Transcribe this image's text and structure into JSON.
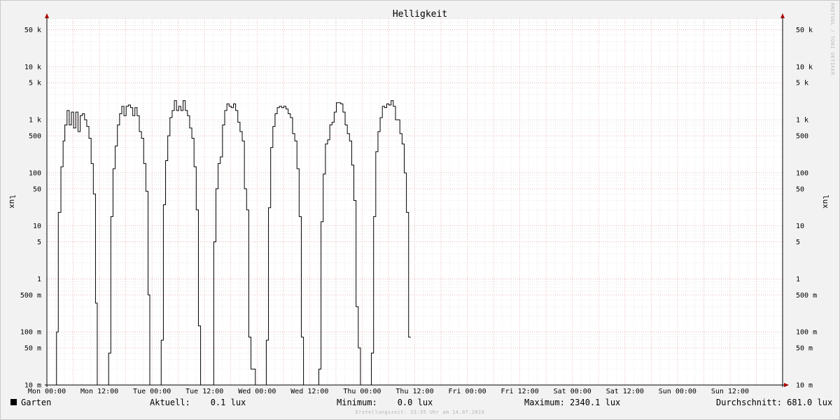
{
  "chart_data": {
    "type": "line",
    "title": "Helligkeit",
    "ylabel": "lux",
    "yscale": "log",
    "ylim": [
      0.01,
      80000
    ],
    "xlim": [
      0,
      168
    ],
    "grid": true,
    "y_tick_values": [
      0.01,
      0.05,
      0.1,
      0.5,
      1,
      5,
      10,
      50,
      100,
      500,
      1000,
      5000,
      10000,
      50000
    ],
    "y_tick_labels": [
      "10 m",
      "50 m",
      "100 m",
      "500 m",
      "1",
      "5",
      "10",
      "50",
      "100",
      "500",
      "1 k",
      "5 k",
      "10 k",
      "50 k"
    ],
    "x_tick_values": [
      0,
      12,
      24,
      36,
      48,
      60,
      72,
      84,
      96,
      108,
      120,
      132,
      144,
      156
    ],
    "x_tick_labels": [
      "Mon 00:00",
      "Mon 12:00",
      "Tue 00:00",
      "Tue 12:00",
      "Wed 00:00",
      "Wed 12:00",
      "Thu 00:00",
      "Thu 12:00",
      "Fri 00:00",
      "Fri 12:00",
      "Sat 00:00",
      "Sat 12:00",
      "Sun 00:00",
      "Sun 12:00"
    ],
    "series": [
      {
        "name": "Garten",
        "color": "#000000",
        "points": [
          [
            0,
            0.01
          ],
          [
            2.2,
            0.01
          ],
          [
            2.2,
            0.1
          ],
          [
            2.6,
            0.1
          ],
          [
            2.6,
            18
          ],
          [
            3.2,
            18
          ],
          [
            3.2,
            130
          ],
          [
            3.7,
            130
          ],
          [
            3.7,
            400
          ],
          [
            4.1,
            400
          ],
          [
            4.1,
            800
          ],
          [
            4.6,
            800
          ],
          [
            4.6,
            1500
          ],
          [
            5.1,
            1500
          ],
          [
            5.1,
            800
          ],
          [
            5.6,
            800
          ],
          [
            5.6,
            1400
          ],
          [
            6.1,
            1400
          ],
          [
            6.1,
            700
          ],
          [
            6.6,
            700
          ],
          [
            6.6,
            1400
          ],
          [
            7.1,
            1400
          ],
          [
            7.1,
            600
          ],
          [
            7.6,
            600
          ],
          [
            7.6,
            1200
          ],
          [
            8.1,
            1200
          ],
          [
            8.1,
            1300
          ],
          [
            8.6,
            1300
          ],
          [
            8.6,
            1000
          ],
          [
            9.1,
            1000
          ],
          [
            9.1,
            750
          ],
          [
            9.6,
            750
          ],
          [
            9.6,
            450
          ],
          [
            10.1,
            450
          ],
          [
            10.1,
            150
          ],
          [
            10.6,
            150
          ],
          [
            10.6,
            40
          ],
          [
            11.1,
            40
          ],
          [
            11.1,
            0.35
          ],
          [
            11.5,
            0.35
          ],
          [
            11.5,
            0.01
          ],
          [
            14.1,
            0.01
          ],
          [
            14.1,
            0.04
          ],
          [
            14.6,
            0.04
          ],
          [
            14.6,
            15
          ],
          [
            15.1,
            15
          ],
          [
            15.1,
            120
          ],
          [
            15.6,
            120
          ],
          [
            15.6,
            320
          ],
          [
            16.1,
            320
          ],
          [
            16.1,
            800
          ],
          [
            16.6,
            800
          ],
          [
            16.6,
            1300
          ],
          [
            17.1,
            1300
          ],
          [
            17.1,
            1800
          ],
          [
            17.6,
            1800
          ],
          [
            17.6,
            1200
          ],
          [
            18.1,
            1200
          ],
          [
            18.1,
            1800
          ],
          [
            18.6,
            1800
          ],
          [
            18.6,
            1900
          ],
          [
            19.1,
            1900
          ],
          [
            19.1,
            1700
          ],
          [
            19.6,
            1700
          ],
          [
            19.6,
            1200
          ],
          [
            20.1,
            1200
          ],
          [
            20.1,
            1700
          ],
          [
            20.6,
            1700
          ],
          [
            20.6,
            1200
          ],
          [
            21.1,
            1200
          ],
          [
            21.1,
            600
          ],
          [
            21.6,
            600
          ],
          [
            21.6,
            450
          ],
          [
            22.1,
            450
          ],
          [
            22.1,
            150
          ],
          [
            22.6,
            150
          ],
          [
            22.6,
            45
          ],
          [
            23.1,
            45
          ],
          [
            23.1,
            0.5
          ],
          [
            23.5,
            0.5
          ],
          [
            23.5,
            0.01
          ],
          [
            26.1,
            0.01
          ],
          [
            26.1,
            0.07
          ],
          [
            26.6,
            0.07
          ],
          [
            26.6,
            25
          ],
          [
            27.1,
            25
          ],
          [
            27.1,
            170
          ],
          [
            27.6,
            170
          ],
          [
            27.6,
            500
          ],
          [
            28.1,
            500
          ],
          [
            28.1,
            1100
          ],
          [
            28.6,
            1100
          ],
          [
            28.6,
            1500
          ],
          [
            29.1,
            1500
          ],
          [
            29.1,
            2300
          ],
          [
            29.6,
            2300
          ],
          [
            29.6,
            1500
          ],
          [
            30.1,
            1500
          ],
          [
            30.1,
            1800
          ],
          [
            30.6,
            1800
          ],
          [
            30.6,
            1500
          ],
          [
            31.1,
            1500
          ],
          [
            31.1,
            2300
          ],
          [
            31.6,
            2300
          ],
          [
            31.6,
            1500
          ],
          [
            32.1,
            1500
          ],
          [
            32.1,
            1200
          ],
          [
            32.6,
            1200
          ],
          [
            32.6,
            700
          ],
          [
            33.1,
            700
          ],
          [
            33.1,
            450
          ],
          [
            33.6,
            450
          ],
          [
            33.6,
            130
          ],
          [
            34.1,
            130
          ],
          [
            34.1,
            20
          ],
          [
            34.6,
            20
          ],
          [
            34.6,
            0.13
          ],
          [
            35.1,
            0.13
          ],
          [
            35.1,
            0.01
          ],
          [
            38.1,
            0.01
          ],
          [
            38.1,
            5
          ],
          [
            38.6,
            5
          ],
          [
            38.6,
            50
          ],
          [
            39.1,
            50
          ],
          [
            39.1,
            150
          ],
          [
            39.6,
            150
          ],
          [
            39.6,
            200
          ],
          [
            40.1,
            200
          ],
          [
            40.1,
            800
          ],
          [
            40.6,
            800
          ],
          [
            40.6,
            1500
          ],
          [
            41.1,
            1500
          ],
          [
            41.1,
            2000
          ],
          [
            41.6,
            2000
          ],
          [
            41.6,
            1800
          ],
          [
            42.1,
            1800
          ],
          [
            42.1,
            1700
          ],
          [
            42.6,
            1700
          ],
          [
            42.6,
            2000
          ],
          [
            43.1,
            2000
          ],
          [
            43.1,
            1500
          ],
          [
            43.6,
            1500
          ],
          [
            43.6,
            900
          ],
          [
            44.1,
            900
          ],
          [
            44.1,
            600
          ],
          [
            44.6,
            600
          ],
          [
            44.6,
            400
          ],
          [
            45.1,
            400
          ],
          [
            45.1,
            50
          ],
          [
            45.6,
            50
          ],
          [
            45.6,
            20
          ],
          [
            46.1,
            20
          ],
          [
            46.1,
            0.08
          ],
          [
            46.6,
            0.08
          ],
          [
            46.6,
            0.02
          ],
          [
            47.6,
            0.02
          ],
          [
            47.6,
            0.01
          ],
          [
            50.1,
            0.01
          ],
          [
            50.1,
            0.07
          ],
          [
            50.6,
            0.07
          ],
          [
            50.6,
            22
          ],
          [
            51.1,
            22
          ],
          [
            51.1,
            300
          ],
          [
            51.6,
            300
          ],
          [
            51.6,
            750
          ],
          [
            52.1,
            750
          ],
          [
            52.1,
            1300
          ],
          [
            52.6,
            1300
          ],
          [
            52.6,
            1700
          ],
          [
            53.1,
            1700
          ],
          [
            53.1,
            1800
          ],
          [
            53.6,
            1800
          ],
          [
            53.6,
            1700
          ],
          [
            54.1,
            1700
          ],
          [
            54.1,
            1800
          ],
          [
            54.6,
            1800
          ],
          [
            54.6,
            1600
          ],
          [
            55.1,
            1600
          ],
          [
            55.1,
            1300
          ],
          [
            55.6,
            1300
          ],
          [
            55.6,
            1100
          ],
          [
            56.1,
            1100
          ],
          [
            56.1,
            550
          ],
          [
            56.6,
            550
          ],
          [
            56.6,
            400
          ],
          [
            57.1,
            400
          ],
          [
            57.1,
            120
          ],
          [
            57.6,
            120
          ],
          [
            57.6,
            15
          ],
          [
            58.1,
            15
          ],
          [
            58.1,
            0.08
          ],
          [
            58.6,
            0.08
          ],
          [
            58.6,
            0.01
          ],
          [
            62.1,
            0.01
          ],
          [
            62.1,
            0.02
          ],
          [
            62.6,
            0.02
          ],
          [
            62.6,
            12
          ],
          [
            63.1,
            12
          ],
          [
            63.1,
            95
          ],
          [
            63.6,
            95
          ],
          [
            63.6,
            350
          ],
          [
            64.1,
            350
          ],
          [
            64.1,
            420
          ],
          [
            64.6,
            420
          ],
          [
            64.6,
            800
          ],
          [
            65.1,
            800
          ],
          [
            65.1,
            900
          ],
          [
            65.6,
            900
          ],
          [
            65.6,
            1400
          ],
          [
            66.1,
            1400
          ],
          [
            66.1,
            2100
          ],
          [
            67.1,
            2100
          ],
          [
            67.1,
            2000
          ],
          [
            67.6,
            2000
          ],
          [
            67.6,
            1400
          ],
          [
            68.1,
            1400
          ],
          [
            68.1,
            800
          ],
          [
            68.6,
            800
          ],
          [
            68.6,
            550
          ],
          [
            69.1,
            550
          ],
          [
            69.1,
            400
          ],
          [
            69.6,
            400
          ],
          [
            69.6,
            140
          ],
          [
            70.1,
            140
          ],
          [
            70.1,
            30
          ],
          [
            70.6,
            30
          ],
          [
            70.6,
            0.3
          ],
          [
            71.1,
            0.3
          ],
          [
            71.1,
            0.05
          ],
          [
            71.6,
            0.05
          ],
          [
            71.6,
            0.01
          ],
          [
            74.1,
            0.01
          ],
          [
            74.1,
            0.04
          ],
          [
            74.6,
            0.04
          ],
          [
            74.6,
            15
          ],
          [
            75.1,
            15
          ],
          [
            75.1,
            250
          ],
          [
            75.6,
            250
          ],
          [
            75.6,
            600
          ],
          [
            76.1,
            600
          ],
          [
            76.1,
            1100
          ],
          [
            76.6,
            1100
          ],
          [
            76.6,
            1800
          ],
          [
            77.1,
            1800
          ],
          [
            77.1,
            1700
          ],
          [
            77.6,
            1700
          ],
          [
            77.6,
            2000
          ],
          [
            78.1,
            2000
          ],
          [
            78.1,
            1900
          ],
          [
            78.6,
            1900
          ],
          [
            78.6,
            2300
          ],
          [
            79.1,
            2300
          ],
          [
            79.1,
            1800
          ],
          [
            79.6,
            1800
          ],
          [
            79.6,
            1000
          ],
          [
            80.1,
            1000
          ],
          [
            80.1,
            1000
          ],
          [
            80.6,
            1000
          ],
          [
            80.6,
            550
          ],
          [
            81.1,
            550
          ],
          [
            81.1,
            350
          ],
          [
            81.6,
            350
          ],
          [
            81.6,
            100
          ],
          [
            82.1,
            100
          ],
          [
            82.1,
            18
          ],
          [
            82.6,
            18
          ],
          [
            82.6,
            0.08
          ],
          [
            83.1,
            0.08
          ]
        ]
      }
    ]
  },
  "legend": {
    "series_label": "Garten",
    "stats": {
      "current": "Aktuell:    0.1 lux",
      "minimum": "Minimum:    0.0 lux",
      "maximum": "Maximum: 2340.1 lux",
      "average": "Durchschnitt: 681.0 lux"
    }
  },
  "watermark": "RRDTOOL / TOBI OETIKER",
  "footer": "Erstellungszeit: 23:55 Uhr am 14.07.2019"
}
